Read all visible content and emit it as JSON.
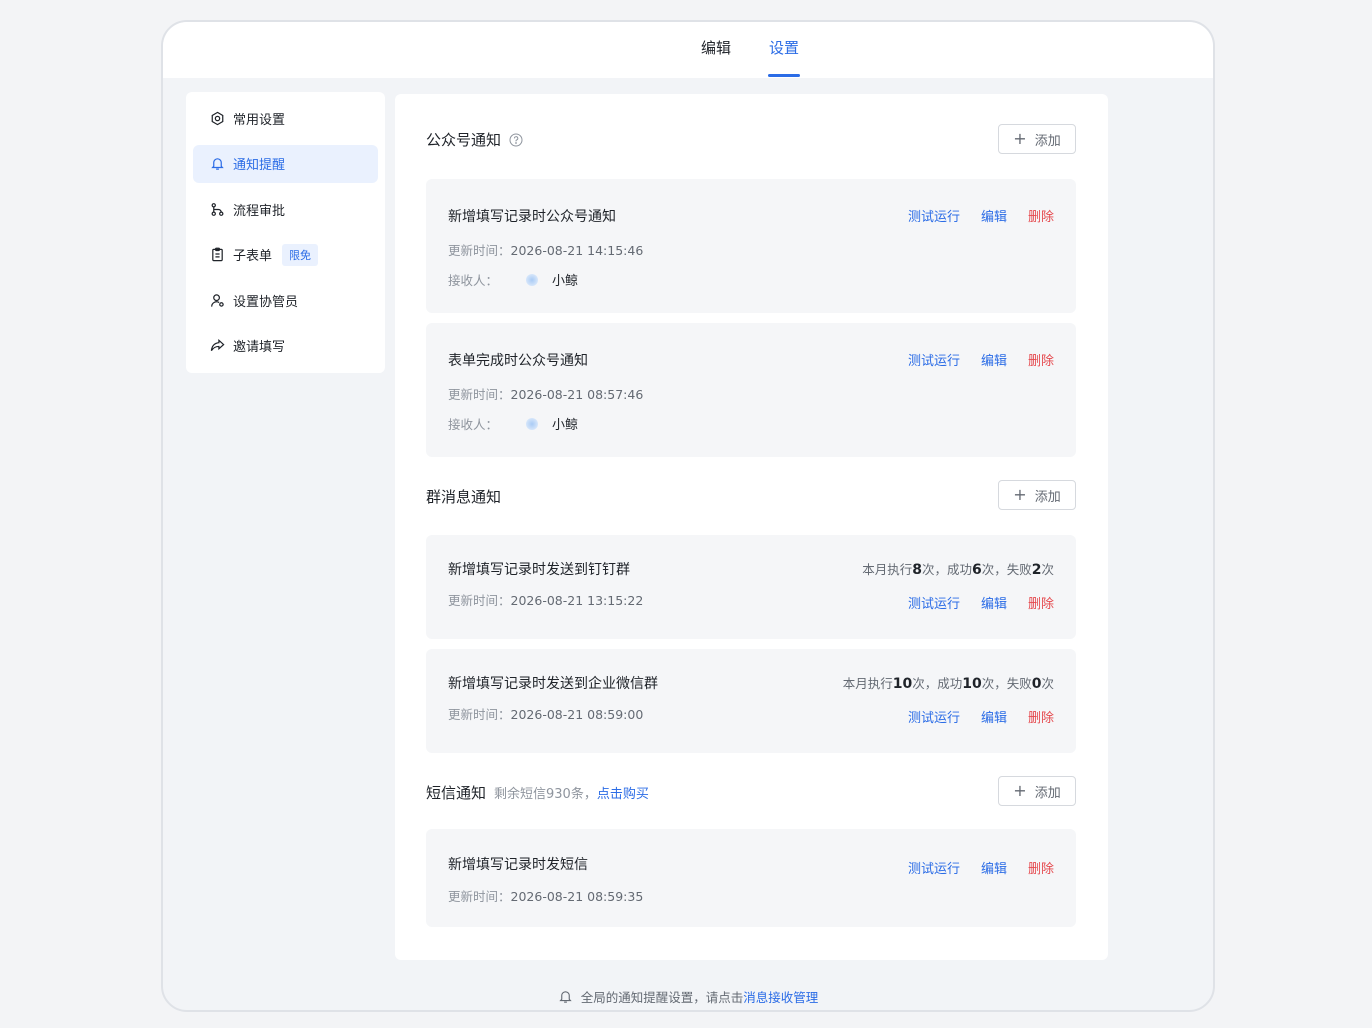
{
  "tabs": [
    {
      "label": "编辑"
    },
    {
      "label": "设置",
      "active": true
    }
  ],
  "sidebar": {
    "items": [
      {
        "label": "常用设置",
        "icon": "gear-icon"
      },
      {
        "label": "通知提醒",
        "icon": "bell-icon",
        "active": true
      },
      {
        "label": "流程审批",
        "icon": "flow-icon"
      },
      {
        "label": "子表单",
        "icon": "clipboard-icon",
        "badge": "限免"
      },
      {
        "label": "设置协管员",
        "icon": "user-gear-icon"
      },
      {
        "label": "邀请填写",
        "icon": "share-icon"
      }
    ]
  },
  "sections": {
    "wechat": {
      "title": "公众号通知",
      "add_label": "添加",
      "cards": [
        {
          "title": "新增填写记录时公众号通知",
          "updated_label": "更新时间：",
          "updated": "2026-08-21 14:15:46",
          "receiver_label": "接收人：",
          "receiver": "小鲸"
        },
        {
          "title": "表单完成时公众号通知",
          "updated_label": "更新时间：",
          "updated": "2026-08-21 08:57:46",
          "receiver_label": "接收人：",
          "receiver": "小鲸"
        }
      ]
    },
    "group": {
      "title": "群消息通知",
      "add_label": "添加",
      "cards": [
        {
          "title": "新增填写记录时发送到钉钉群",
          "updated_label": "更新时间：",
          "updated": "2026-08-21 13:15:22",
          "stats": {
            "p1": "本月执行",
            "exec": "8",
            "p2": "次，成功",
            "success": "6",
            "p3": "次，失败",
            "fail": "2",
            "p4": "次"
          }
        },
        {
          "title": "新增填写记录时发送到企业微信群",
          "updated_label": "更新时间：",
          "updated": "2026-08-21 08:59:00",
          "stats": {
            "p1": "本月执行",
            "exec": "10",
            "p2": "次，成功",
            "success": "10",
            "p3": "次，失败",
            "fail": "0",
            "p4": "次"
          }
        }
      ]
    },
    "sms": {
      "title": "短信通知",
      "note": "剩余短信930条，",
      "buy_link": "点击购买",
      "add_label": "添加",
      "cards": [
        {
          "title": "新增填写记录时发短信",
          "updated_label": "更新时间：",
          "updated": "2026-08-21 08:59:35"
        }
      ]
    }
  },
  "actions": {
    "test": "测试运行",
    "edit": "编辑",
    "delete": "删除"
  },
  "footer": {
    "text": "全局的通知提醒设置，请点击",
    "link": "消息接收管理"
  },
  "colors": {
    "accent": "#2b6ce6",
    "danger": "#e5484d"
  }
}
